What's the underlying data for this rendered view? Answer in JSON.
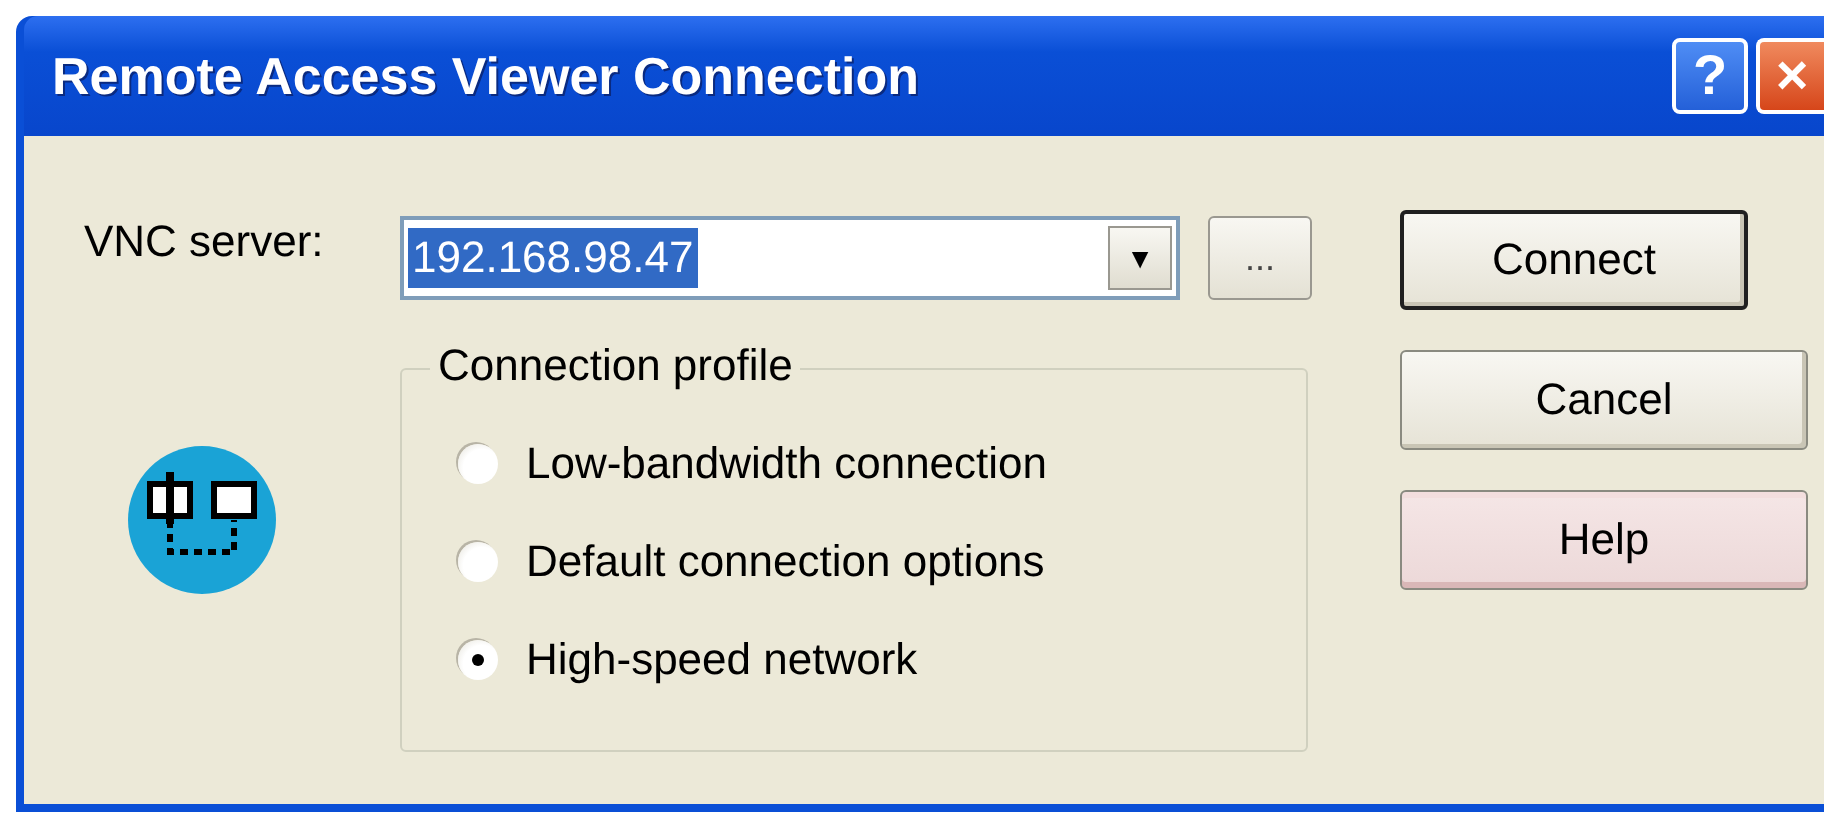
{
  "window": {
    "title": "Remote Access Viewer Connection",
    "help_button": "?",
    "close_button": "×"
  },
  "server": {
    "label": "VNC server:",
    "value": "192.168.98.47",
    "selected": true,
    "dropdown": "▼",
    "browse": "..."
  },
  "profile": {
    "title": "Connection profile",
    "options": [
      {
        "label": "Low-bandwidth connection",
        "selected": false
      },
      {
        "label": "Default connection options",
        "selected": false
      },
      {
        "label": "High-speed network",
        "selected": true
      }
    ]
  },
  "buttons": [
    {
      "label": "Connect",
      "default": true,
      "hovered": false
    },
    {
      "label": "Cancel",
      "default": false,
      "hovered": false
    },
    {
      "label": "Help",
      "default": false,
      "hovered": true
    }
  ]
}
